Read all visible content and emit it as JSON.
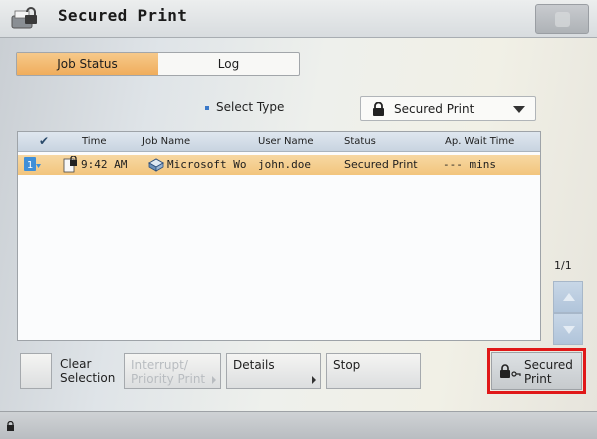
{
  "window": {
    "title": "Secured Print"
  },
  "tabs": [
    {
      "label": "Job Status",
      "active": true
    },
    {
      "label": "Log",
      "active": false
    }
  ],
  "filter": {
    "label": "Select Type",
    "selected": "Secured Print"
  },
  "table": {
    "headers": {
      "check": "✔",
      "time": "Time",
      "job_name": "Job Name",
      "user_name": "User Name",
      "status": "Status",
      "wait": "Ap. Wait Time"
    },
    "rows": [
      {
        "time": "9:42 AM",
        "job_name": "Microsoft Wo",
        "user_name": "john.doe",
        "status": "Secured Print",
        "wait": "--- mins",
        "selected": true
      }
    ]
  },
  "pager": {
    "page": "1/1"
  },
  "buttons": {
    "clear_selection": "Clear\nSelection",
    "interrupt": "Interrupt/\nPriority Print",
    "details": "Details",
    "stop": "Stop",
    "secured_print": "Secured\nPrint"
  },
  "colors": {
    "accent": "#f0ad5c",
    "highlight": "#e01818",
    "header": "#c8d4e0"
  }
}
